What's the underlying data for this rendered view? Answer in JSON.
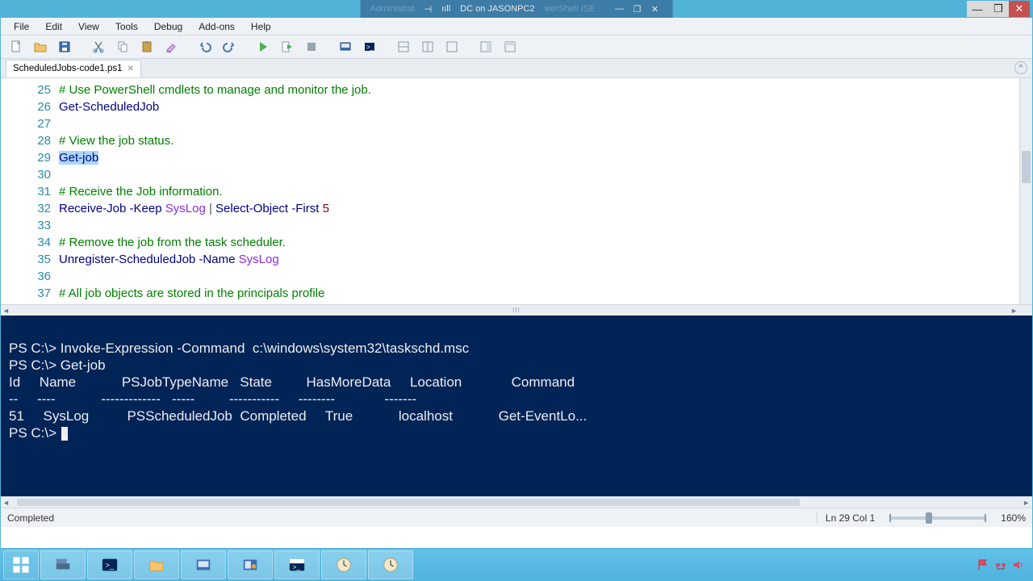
{
  "vm": {
    "title_left": "Administrat",
    "title_mid": "DC on JASONPC2",
    "title_right": "werShell ISE"
  },
  "menu": {
    "file": "File",
    "edit": "Edit",
    "view": "View",
    "tools": "Tools",
    "debug": "Debug",
    "addons": "Add-ons",
    "help": "Help"
  },
  "tab": {
    "name": "ScheduledJobs-code1.ps1"
  },
  "code": {
    "lines": [
      {
        "n": 25,
        "kind": "comment",
        "text": "# Use PowerShell cmdlets to manage and monitor the job."
      },
      {
        "n": 26,
        "kind": "cmdlet",
        "text": "Get-ScheduledJob"
      },
      {
        "n": 27,
        "kind": "blank",
        "text": ""
      },
      {
        "n": 28,
        "kind": "comment",
        "text": "# View the job status."
      },
      {
        "n": 29,
        "kind": "cmdlet_sel",
        "text": "Get-job"
      },
      {
        "n": 30,
        "kind": "blank",
        "text": ""
      },
      {
        "n": 31,
        "kind": "comment",
        "text": "# Receive the Job information."
      },
      {
        "n": 32,
        "kind": "receive",
        "cmd": "Receive-Job",
        "p1": "-Keep",
        "a1": "SysLog",
        "pipe": "|",
        "cmd2": "Select-Object",
        "p2": "-First",
        "num": "5"
      },
      {
        "n": 33,
        "kind": "blank",
        "text": ""
      },
      {
        "n": 34,
        "kind": "comment",
        "text": "# Remove the job from the task scheduler."
      },
      {
        "n": 35,
        "kind": "unreg",
        "cmd": "Unregister-ScheduledJob",
        "p1": "-Name",
        "a1": "SysLog"
      },
      {
        "n": 36,
        "kind": "blank",
        "text": ""
      },
      {
        "n": 37,
        "kind": "comment",
        "text": "# All job objects are stored in the principals profile"
      }
    ]
  },
  "console": {
    "l1_a": "PS C:\\> ",
    "l1_b": "Invoke-Expression",
    "l1_c": " -Command",
    "l1_d": "  c:\\windows\\system32\\taskschd.msc ",
    "l3": "PS C:\\> Get-job",
    "hdr": "Id     Name            PSJobTypeName   State         HasMoreData     Location             Command         ",
    "sep": "--     ----            -------------   -----         -----------     --------             -------         ",
    "row": "51     SysLog          PSScheduledJob  Completed     True            localhost            Get-EventLo...  ",
    "prompt": "PS C:\\> "
  },
  "status": {
    "left": "Completed",
    "pos": "Ln 29  Col 1",
    "zoom": "160%"
  },
  "icons": {
    "pin": "⇵",
    "signal": "₊ıll"
  }
}
